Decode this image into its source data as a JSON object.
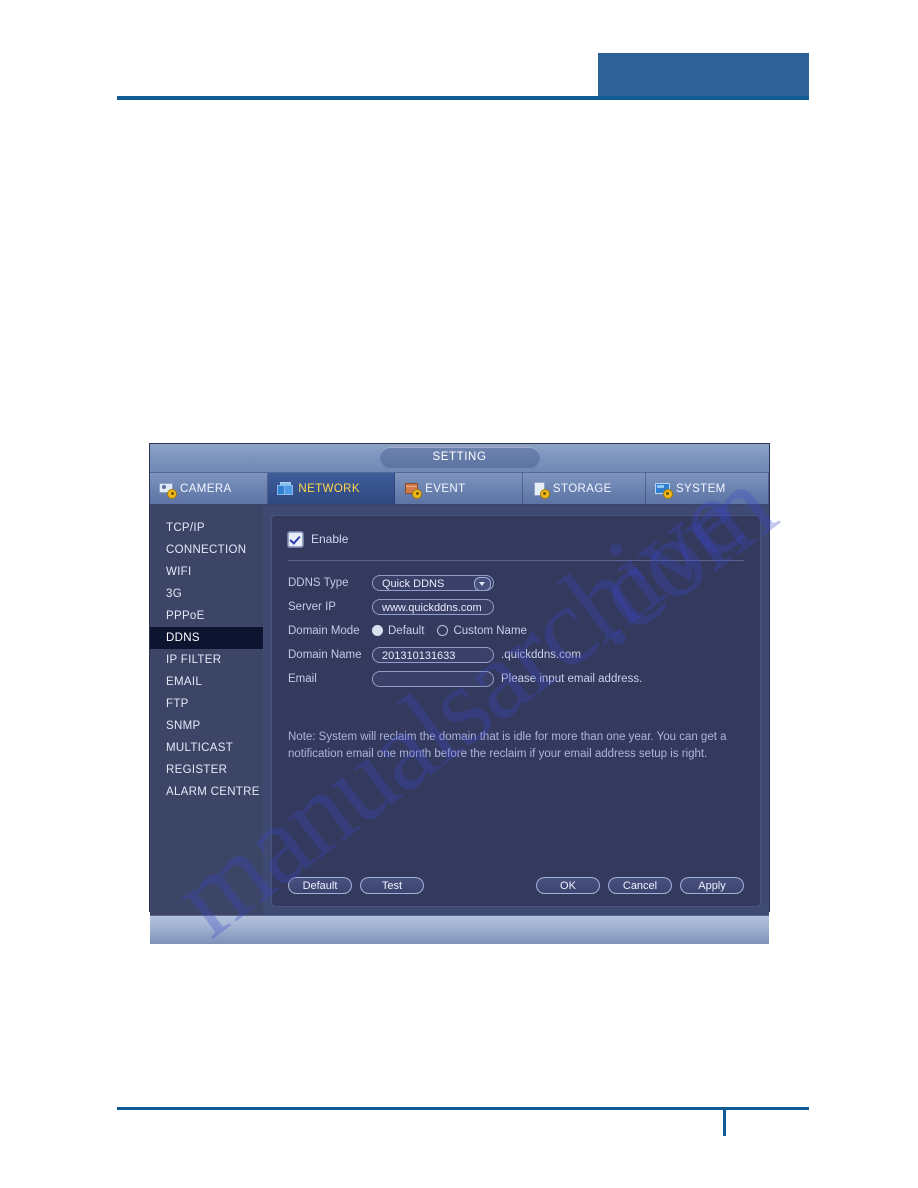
{
  "dialog": {
    "title": "SETTING",
    "tabs": [
      {
        "label": "CAMERA",
        "icon": "camera-icon",
        "active": false
      },
      {
        "label": "NETWORK",
        "icon": "network-icon",
        "active": true
      },
      {
        "label": "EVENT",
        "icon": "event-icon",
        "active": false
      },
      {
        "label": "STORAGE",
        "icon": "storage-icon",
        "active": false
      },
      {
        "label": "SYSTEM",
        "icon": "system-icon",
        "active": false
      }
    ],
    "sidebar": {
      "items": [
        {
          "label": "TCP/IP",
          "active": false
        },
        {
          "label": "CONNECTION",
          "active": false
        },
        {
          "label": "WIFI",
          "active": false
        },
        {
          "label": "3G",
          "active": false
        },
        {
          "label": "PPPoE",
          "active": false
        },
        {
          "label": "DDNS",
          "active": true
        },
        {
          "label": "IP FILTER",
          "active": false
        },
        {
          "label": "EMAIL",
          "active": false
        },
        {
          "label": "FTP",
          "active": false
        },
        {
          "label": "SNMP",
          "active": false
        },
        {
          "label": "MULTICAST",
          "active": false
        },
        {
          "label": "REGISTER",
          "active": false
        },
        {
          "label": "ALARM CENTRE",
          "active": false
        }
      ]
    },
    "form": {
      "enable_label": "Enable",
      "enable_checked": true,
      "ddns_type_label": "DDNS Type",
      "ddns_type_value": "Quick DDNS",
      "server_ip_label": "Server IP",
      "server_ip_value": "www.quickddns.com",
      "domain_mode_label": "Domain Mode",
      "domain_mode_default": "Default",
      "domain_mode_custom": "Custom Name",
      "domain_mode_selected": "Default",
      "domain_name_label": "Domain Name",
      "domain_name_value": "201310131633",
      "domain_name_suffix": ".quickddns.com",
      "email_label": "Email",
      "email_value": "",
      "email_hint": "Please input email address.",
      "note": "Note: System will reclaim the domain that is idle for more than one year. You can get a notification email one month before the reclaim if your email address setup is right."
    },
    "buttons": {
      "default": "Default",
      "test": "Test",
      "ok": "OK",
      "cancel": "Cancel",
      "apply": "Apply"
    }
  },
  "page": {
    "watermark_line_a": "manualsarchive",
    "watermark_line_b": ".com",
    "accent_color": "#0f5c94",
    "header_block_color": "#2e6296"
  }
}
